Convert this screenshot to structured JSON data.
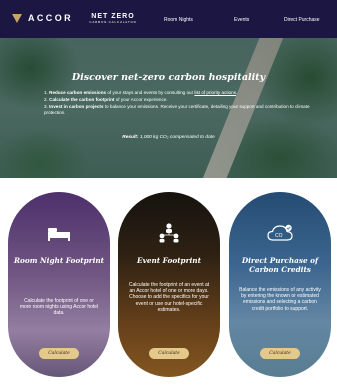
{
  "nav": {
    "brand": "ACCOR",
    "netzero_title": "NET ZERO",
    "netzero_subtitle": "CARBON CALCULATOR",
    "links": [
      "Room Nights",
      "Events",
      "Direct Purchase"
    ]
  },
  "hero": {
    "title": "Discover net-zero carbon hospitality",
    "steps": [
      {
        "num": "1.",
        "bold": "Reduce carbon emissions",
        "text": " of your stays and events by consulting our ",
        "link": "list of priority actions",
        "end": "."
      },
      {
        "num": "2.",
        "bold": "Calculate the carbon footprint",
        "text": " of your Accor experience.",
        "link": "",
        "end": ""
      },
      {
        "num": "3.",
        "bold": "Invest in carbon projects",
        "text": " to balance your emissions. Receive your certificate, detailing your support and contribution to climate protection.",
        "link": "",
        "end": ""
      }
    ],
    "result_label": "Result:",
    "result_value": "1,000 kg CO₂ compensated to date"
  },
  "cards": [
    {
      "title": "Room Night Footprint",
      "icon": "bed-icon",
      "description": "Calculate the footprint of one or more room nights using Accor hotel data.",
      "button": "Calculate"
    },
    {
      "title": "Event Footprint",
      "icon": "people-icon",
      "description": "Calculate the footprint of an event at an Accor hotel of one or more days. Choose to add the specifics for your event or use our hotel-specific estimates.",
      "button": "Calculate"
    },
    {
      "title": "Direct Purchase of Carbon Credits",
      "icon": "co2-cloud-icon",
      "description": "Balance the emissions of any activity by entering the known or estimated emissions and selecting a carbon credit portfolio to support.",
      "button": "Calculate"
    }
  ],
  "colors": {
    "nav_bg": "#1b1742",
    "accent_gold": "#c8a46b",
    "button_gold": "#e4c98a"
  }
}
